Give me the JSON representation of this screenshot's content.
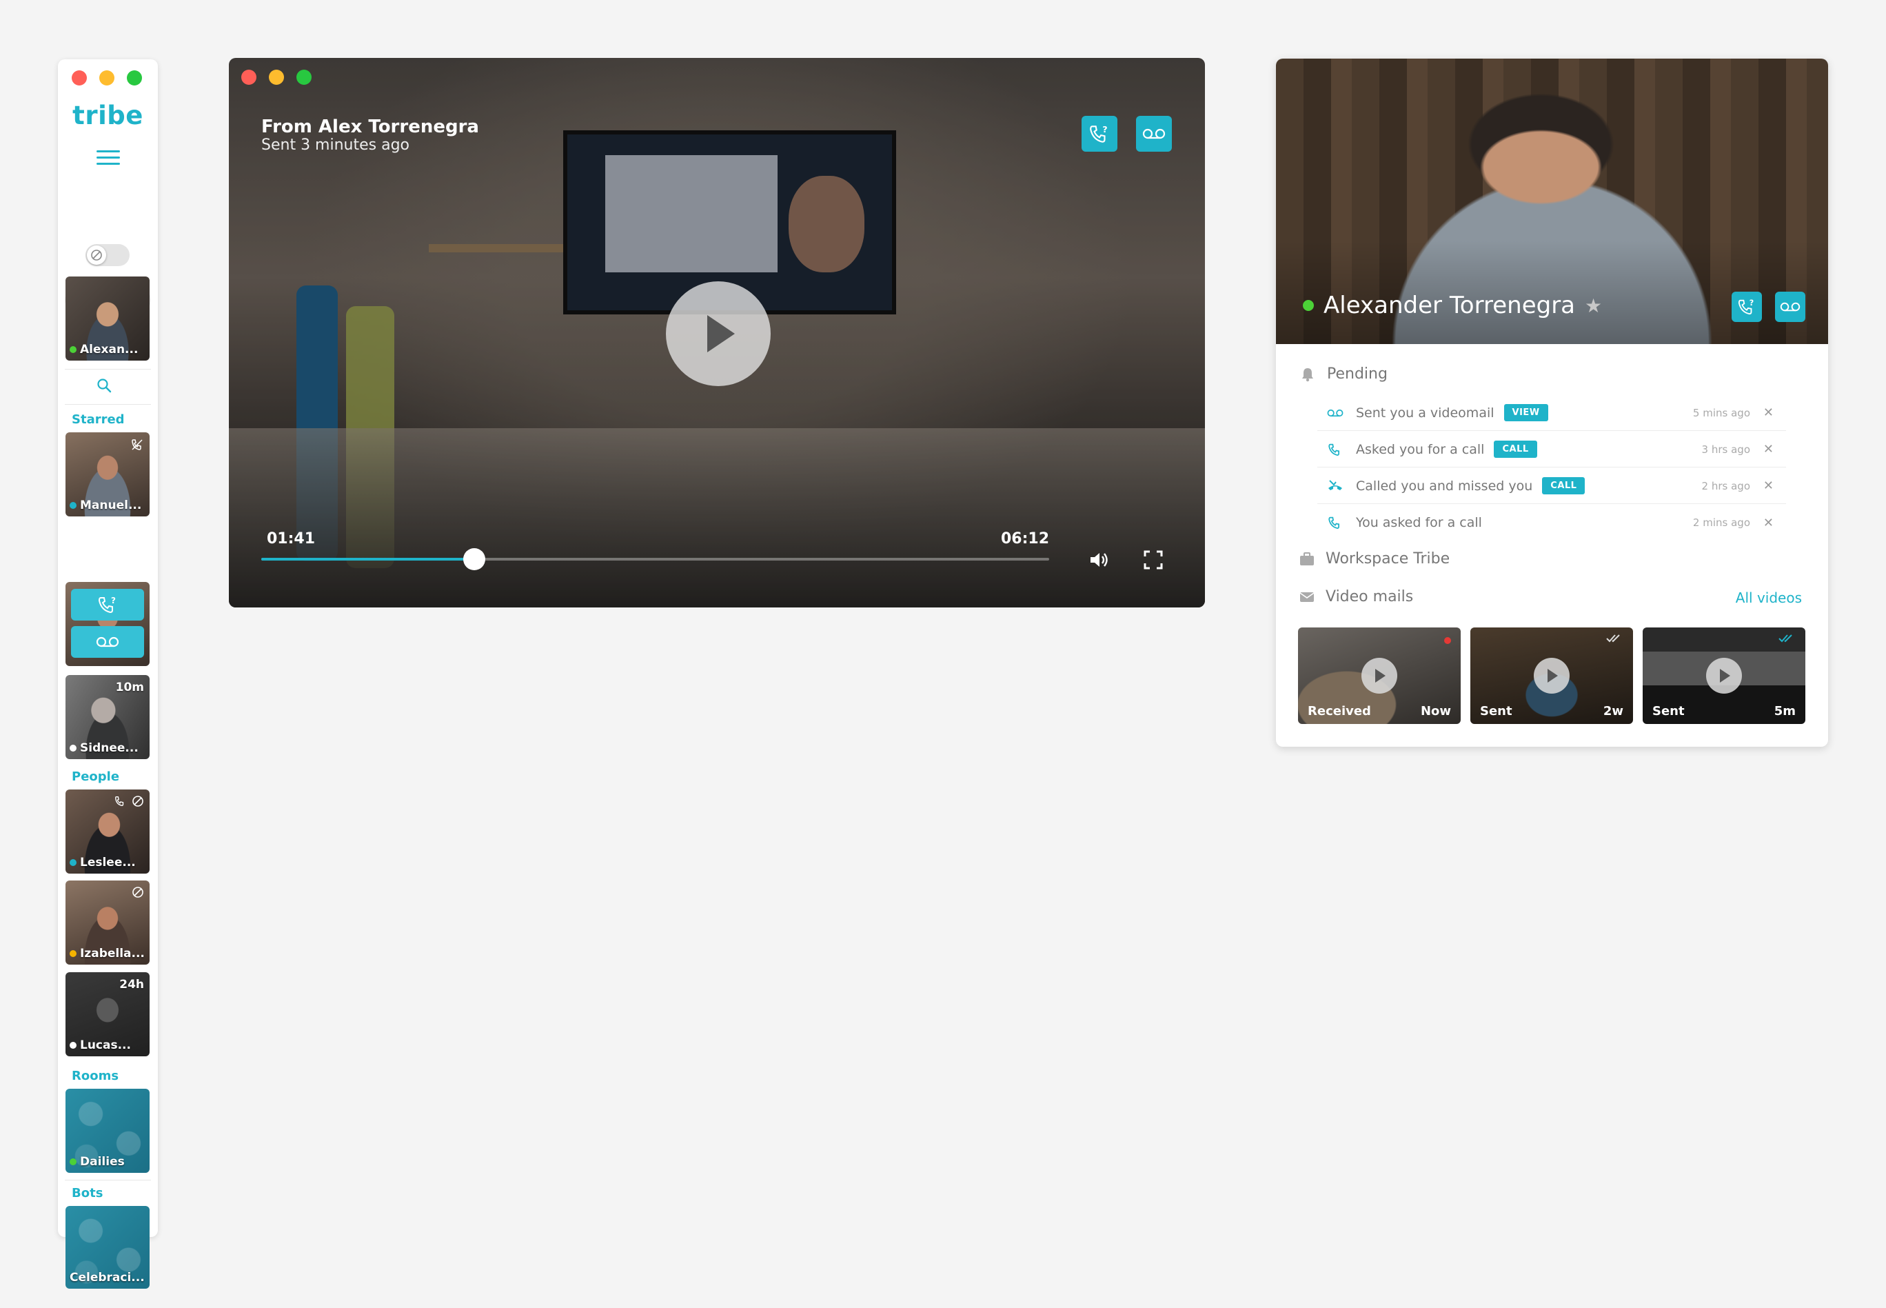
{
  "sidebar": {
    "brand": "tribe",
    "me": {
      "name": "Alexan...",
      "status_color": "#4cd137"
    },
    "sections": {
      "starred": "Starred",
      "people": "People",
      "rooms": "Rooms",
      "bots": "Bots"
    },
    "starred": [
      {
        "name": "Manuel...",
        "status_color": "#1fb3c9"
      },
      {
        "name": "Sidnee...",
        "status_color": "#ffffff",
        "badge": "10m"
      }
    ],
    "people": [
      {
        "name": "Leslee...",
        "status_color": "#1fb3c9"
      },
      {
        "name": "Izabella...",
        "status_color": "#f5b400"
      },
      {
        "name": "Lucas...",
        "status_color": "#ffffff",
        "badge": "24h"
      }
    ],
    "rooms": [
      {
        "name": "Dailies",
        "status_color": "#4cd137"
      }
    ],
    "bots": [
      {
        "name": "Celebraci..."
      }
    ]
  },
  "player": {
    "title": "From Alex Torrenegra",
    "subtitle": "Sent 3 minutes ago",
    "current_time": "01:41",
    "duration": "06:12",
    "progress": 0.27
  },
  "card": {
    "name": "Alexander Torrenegra",
    "pending_label": "Pending",
    "pending": [
      {
        "icon": "videomail-icon",
        "text": "Sent you a videomail",
        "action": "VIEW",
        "ago": "5 mins ago"
      },
      {
        "icon": "phone-request-icon",
        "text": "Asked you for a call",
        "action": "CALL",
        "ago": "3 hrs ago"
      },
      {
        "icon": "missed-call-icon",
        "text": "Called you and missed you",
        "action": "CALL",
        "ago": "2 hrs ago"
      },
      {
        "icon": "phone-request-icon",
        "text": "You asked for a call",
        "action": "",
        "ago": "2 mins ago"
      }
    ],
    "workspace_label": "Workspace Tribe",
    "videomails_label": "Video mails",
    "all_videos": "All videos",
    "videos": [
      {
        "left": "Received",
        "right": "Now"
      },
      {
        "left": "Sent",
        "right": "2w"
      },
      {
        "left": "Sent",
        "right": "5m"
      }
    ]
  },
  "colors": {
    "accent": "#1fb3c9",
    "online": "#4cd137"
  }
}
